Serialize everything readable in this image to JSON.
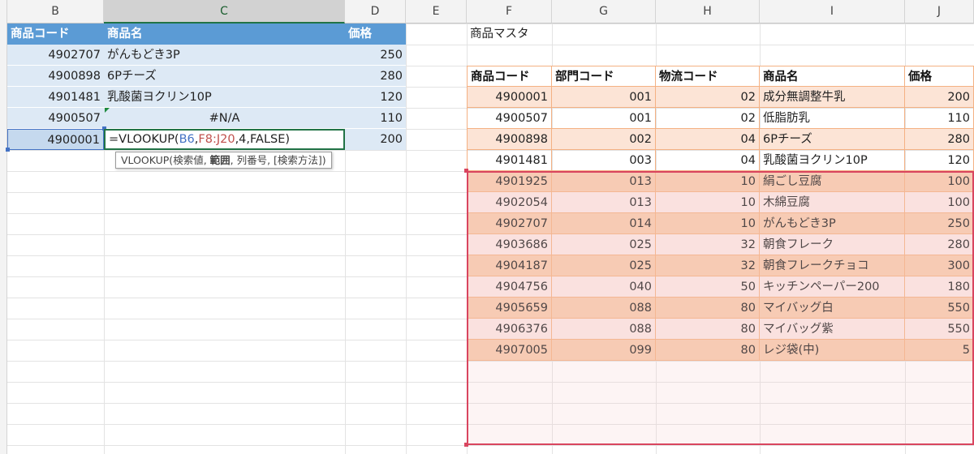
{
  "columns": [
    "B",
    "C",
    "D",
    "E",
    "F",
    "G",
    "H",
    "I",
    "J"
  ],
  "lookup_table": {
    "headers": [
      "商品コード",
      "商品名",
      "価格"
    ],
    "rows": [
      {
        "code": "4902707",
        "name": "がんもどき3P",
        "price": "250"
      },
      {
        "code": "4900898",
        "name": "6Pチーズ",
        "price": "280"
      },
      {
        "code": "4901481",
        "name": "乳酸菌ヨクリン10P",
        "price": "120"
      },
      {
        "code": "4900507",
        "name": "#N/A",
        "price": "110"
      },
      {
        "code": "4900001",
        "name": "",
        "price": "200"
      }
    ],
    "editing_formula": {
      "prefix": "=VLOOKUP(",
      "arg1": "B6",
      "sep1": ",",
      "arg2": "F8:J20",
      "rest": ",4,FALSE)"
    },
    "tooltip": {
      "func": "VLOOKUP(",
      "p1": "検索値, ",
      "p2": "範囲",
      "p3": ", 列番号, [検索方法])"
    }
  },
  "master": {
    "title": "商品マスタ",
    "headers": [
      "商品コード",
      "部門コード",
      "物流コード",
      "商品名",
      "価格"
    ],
    "rows": [
      {
        "code": "4900001",
        "dept": "001",
        "logi": "02",
        "name": "成分無調整牛乳",
        "price": "200"
      },
      {
        "code": "4900507",
        "dept": "001",
        "logi": "02",
        "name": "低脂肪乳",
        "price": "110"
      },
      {
        "code": "4900898",
        "dept": "002",
        "logi": "04",
        "name": "6Pチーズ",
        "price": "280"
      },
      {
        "code": "4901481",
        "dept": "003",
        "logi": "04",
        "name": "乳酸菌ヨクリン10P",
        "price": "120"
      },
      {
        "code": "4901925",
        "dept": "013",
        "logi": "10",
        "name": "絹ごし豆腐",
        "price": "100"
      },
      {
        "code": "4902054",
        "dept": "013",
        "logi": "10",
        "name": "木綿豆腐",
        "price": "100"
      },
      {
        "code": "4902707",
        "dept": "014",
        "logi": "10",
        "name": "がんもどき3P",
        "price": "250"
      },
      {
        "code": "4903686",
        "dept": "025",
        "logi": "32",
        "name": "朝食フレーク",
        "price": "280"
      },
      {
        "code": "4904187",
        "dept": "025",
        "logi": "32",
        "name": "朝食フレークチョコ",
        "price": "300"
      },
      {
        "code": "4904756",
        "dept": "040",
        "logi": "50",
        "name": "キッチンペーパー200",
        "price": "180"
      },
      {
        "code": "4905659",
        "dept": "088",
        "logi": "80",
        "name": "マイバッグ白",
        "price": "550"
      },
      {
        "code": "4906376",
        "dept": "088",
        "logi": "80",
        "name": "マイバッグ紫",
        "price": "550"
      },
      {
        "code": "4907005",
        "dept": "099",
        "logi": "80",
        "name": "レジ袋(中)",
        "price": "5"
      }
    ]
  },
  "colors": {
    "header_blue": "#5b9bd5",
    "formula_ref_blue": "#4472c4",
    "formula_ref_red": "#c0504d",
    "range_border": "#d9455f",
    "excel_green": "#217346"
  }
}
